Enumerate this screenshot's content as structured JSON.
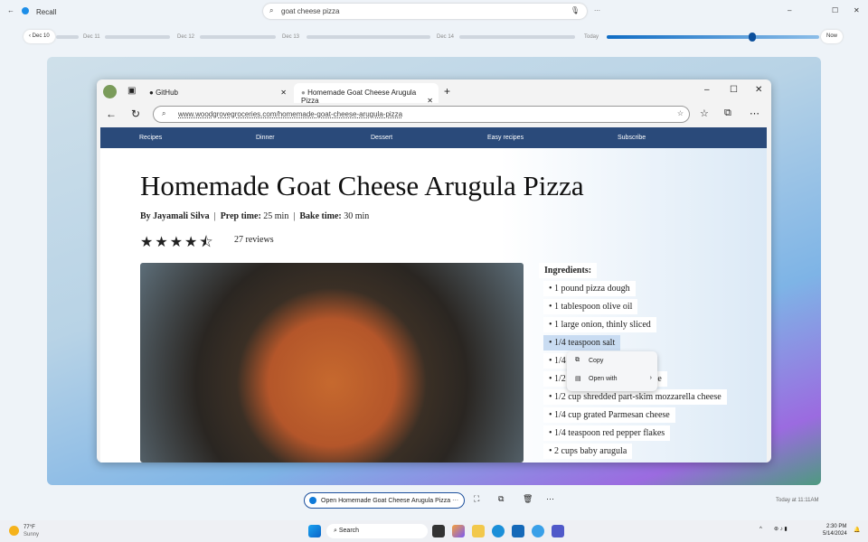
{
  "app": {
    "title": "Recall",
    "search_value": "goat cheese pizza"
  },
  "timeline": {
    "labels": [
      "Dec 10",
      "Dec 11",
      "Dec 12",
      "Dec 13",
      "Dec 14",
      "Today",
      "Now"
    ],
    "position_percent": 68
  },
  "browser": {
    "tabs": [
      {
        "label": "GitHub"
      },
      {
        "label": "Homemade Goat Cheese Arugula Pizza"
      }
    ],
    "url": "www.woodgrovegroceries.com/homemade-goat-cheese-arugula-pizza"
  },
  "site": {
    "nav": [
      "Recipes",
      "Dinner",
      "Dessert",
      "Easy recipes",
      "Subscribe"
    ],
    "title": "Homemade Goat Cheese Arugula Pizza",
    "author_prefix": "By Jayamali Silva",
    "prep_label": "Prep time:",
    "prep_value": "25 min",
    "bake_label": "Bake time:",
    "bake_value": "30 min",
    "rating": 4.5,
    "stars": "★★★★⯪",
    "reviews": "27 reviews",
    "ingredients_title": "Ingredients:",
    "ingredients": [
      "1 pound pizza dough",
      "1 tablespoon olive oil",
      "1 large onion, thinly sliced",
      "1/4 teaspoon salt",
      "1/4 teaspoon black pepper",
      "1/2 cup crumbled goat cheese",
      "1/2 cup shredded part-skim mozzarella cheese",
      "1/4 cup grated Parmesan cheese",
      "1/4 teaspoon red pepper flakes",
      "2 cups baby arugula"
    ],
    "visible_partial": [
      "1/4",
      "black pepper",
      "1/2",
      "e"
    ]
  },
  "context_menu": [
    "Copy",
    "Open with"
  ],
  "action": {
    "open_label": "Open Homemade Goat Cheese Arugula Pizza",
    "timestamp": "Today at 11:11AM"
  },
  "taskbar": {
    "weather_temp": "77°F",
    "weather_desc": "Sunny",
    "search": "Search",
    "time": "2:30 PM",
    "date": "5/14/2024"
  },
  "colors": {
    "accent": "#0067c0",
    "nav": "#2a4a7a"
  }
}
